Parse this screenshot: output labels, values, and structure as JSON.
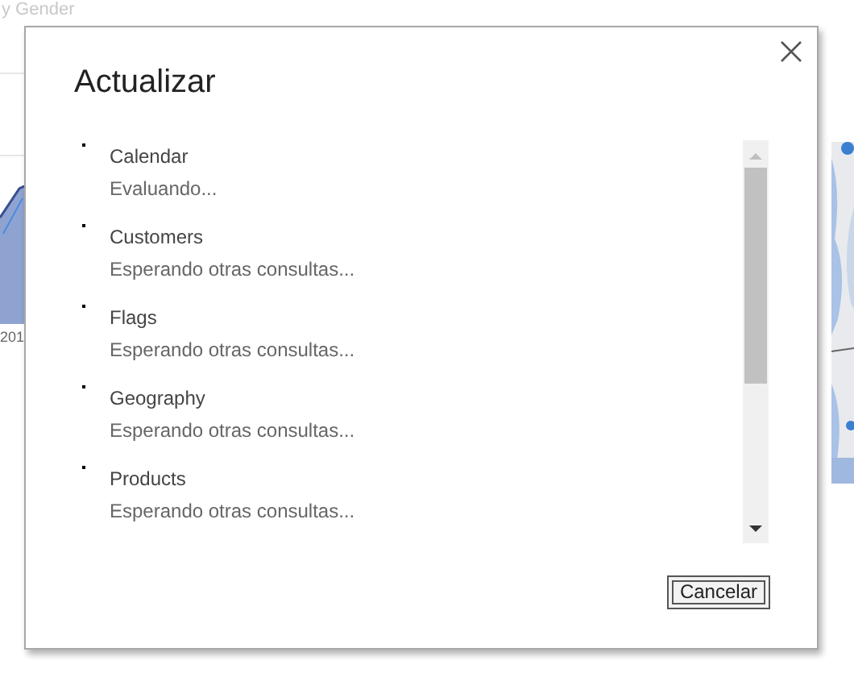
{
  "report": {
    "visual_title": "y Gender",
    "axis_label": "201"
  },
  "dialog": {
    "title": "Actualizar",
    "queries": [
      {
        "name": "Calendar",
        "status": "Evaluando..."
      },
      {
        "name": "Customers",
        "status": "Esperando otras consultas..."
      },
      {
        "name": "Flags",
        "status": "Esperando otras consultas..."
      },
      {
        "name": "Geography",
        "status": "Esperando otras consultas..."
      },
      {
        "name": "Products",
        "status": "Esperando otras consultas..."
      }
    ],
    "buttons": [
      "Cancelar"
    ]
  }
}
